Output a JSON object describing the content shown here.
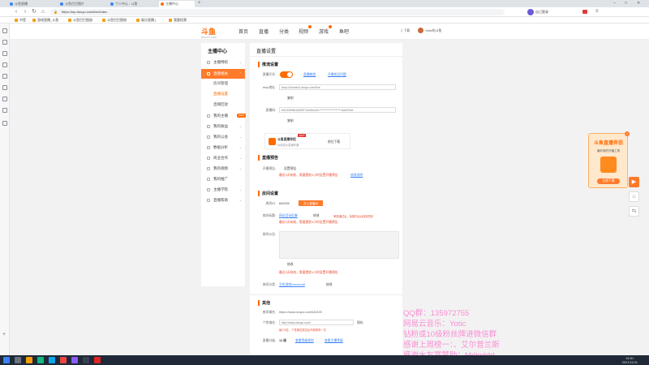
{
  "browser": {
    "tabs": [
      {
        "label": "斗鱼直播"
      },
      {
        "label": "斗鱼巴巴图片"
      },
      {
        "label": "个人中心 - 斗鱼"
      },
      {
        "label": "主播中心"
      }
    ],
    "url": "https://mp.douyu.com/live/index",
    "profile_label": "自己登录",
    "bookmarks": [
      "书签",
      "游戏直播_斗鱼",
      "斗鱼巴巴图册",
      "斗鱼巴巴图册",
      "娱乐直播 |",
      "我要投票"
    ]
  },
  "header": {
    "logo": "斗鱼",
    "logo_sub": "DOUYU.COM",
    "nav": [
      "首页",
      "直播",
      "分类",
      "视频",
      "游戏",
      "鱼吧"
    ],
    "right_label": "下载",
    "user": "Yotic的斗鱼"
  },
  "sidebar": {
    "title": "主播中心",
    "items": [
      {
        "label": "主播特权"
      },
      {
        "label": "直播相关"
      },
      {
        "label": "我的主播"
      },
      {
        "label": "我的收益"
      },
      {
        "label": "我的公会"
      },
      {
        "label": "数据分析"
      },
      {
        "label": "商业合作"
      },
      {
        "label": "我的视频"
      },
      {
        "label": "我的推广"
      },
      {
        "label": "主播学院"
      },
      {
        "label": "直播帮助"
      }
    ],
    "sub_items": [
      {
        "label": "房间管理"
      },
      {
        "label": "直播设置"
      },
      {
        "label": "直播回放"
      }
    ],
    "new_pill": "NEW"
  },
  "main": {
    "page_title": "直播设置",
    "sections": {
      "push": "推流设置",
      "notice": "直播预告",
      "room": "房间设置",
      "other": "其他"
    },
    "push": {
      "toggle_label": "直播开关:",
      "link1": "直播教程",
      "link2": "开播常见问题",
      "rtmp_label": "rtmp地址:",
      "rtmp_value": "rtmp://sendtc3.douyu.com/live",
      "copy": "复制",
      "code_label": "直播码:",
      "code_value": "642425rI8rAd9ZK?wsSecret=*******************&wsTime",
      "tool_name": "斗鱼直播伴侣",
      "tool_desc": "功能强大直播利器",
      "tool_btn": "前往下载"
    },
    "notice": {
      "label": "开播预告:",
      "set_btn": "设置预告",
      "warn": "最近3天有效，需要提前1小时设置开播预告",
      "link": "修改说明"
    },
    "room": {
      "room_id_label": "房间ID:",
      "room_id_value": "642425",
      "room_id_btn": "进入直播间",
      "title_label": "房间标题:",
      "title_value": "网站活动征集",
      "edit": "修改",
      "title_hint": "审核通过后，标题与后台保持同步",
      "title_warn": "最近3天有效，需要提前1小时设置开播预告",
      "notice_label": "房间公告:",
      "notice_warn": "最近3天有效，需要提前1小时设置开播预告",
      "cat_label": "房间分类:",
      "cat_value": "主机游戏/minecraft",
      "cat_btn": "修改"
    },
    "other": {
      "domain_label": "房间域名:",
      "domain_value": "https://www.douyu.com/642425",
      "custom_label": "个性域名:",
      "custom_value": "http://www.douyu.com/",
      "custom_btn": "保存",
      "custom_warn": "最少5位，个性域名提交后不能修改一次",
      "level_label": "直播分级:",
      "level_value": "12 级",
      "level_link1": "查看等级规则",
      "level_link2": "查看主播等级"
    }
  },
  "promo": {
    "title": "斗鱼直播伴侣",
    "desc": "最好用的开播工具",
    "btn": "立即下载"
  },
  "overlay": {
    "lines": [
      "QQ群：135972755",
      "网易云音乐：Yotic",
      "钻粉或10级粉丝牌进微信群",
      "感谢上周榜一：、艾尔普兰斯",
      "感谢水友赛赞助：Mrlinddd"
    ]
  },
  "taskbar": {
    "time": "16:51",
    "date": "2021/11/11"
  }
}
